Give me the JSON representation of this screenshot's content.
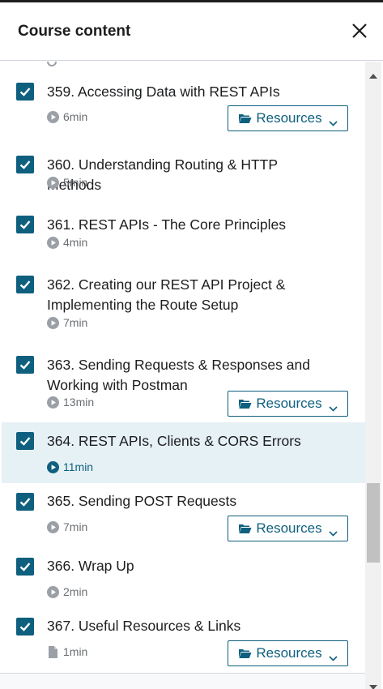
{
  "panel": {
    "title": "Course content"
  },
  "lectures": [
    {
      "title": "359. Accessing Data with REST APIs",
      "duration": "6min",
      "type_icon": "play-circle-icon",
      "completed": true,
      "has_resources": true
    },
    {
      "title": "360. Understanding Routing & HTTP Methods",
      "duration": "5min",
      "type_icon": "play-circle-icon",
      "completed": true,
      "has_resources": false
    },
    {
      "title": "361. REST APIs - The Core Principles",
      "duration": "4min",
      "type_icon": "play-circle-icon",
      "completed": true,
      "has_resources": false
    },
    {
      "title": "362. Creating our REST API Project & Implementing the Route Setup",
      "duration": "7min",
      "type_icon": "play-circle-icon",
      "completed": true,
      "has_resources": false
    },
    {
      "title": "363. Sending Requests & Responses and Working with Postman",
      "duration": "13min",
      "type_icon": "play-circle-icon",
      "completed": true,
      "has_resources": true
    },
    {
      "title": "364. REST APIs, Clients & CORS Errors",
      "duration": "11min",
      "type_icon": "play-circle-icon",
      "completed": true,
      "has_resources": false,
      "active": true
    },
    {
      "title": "365. Sending POST Requests",
      "duration": "7min",
      "type_icon": "play-circle-icon",
      "completed": true,
      "has_resources": true
    },
    {
      "title": "366. Wrap Up",
      "duration": "2min",
      "type_icon": "play-circle-icon",
      "completed": true,
      "has_resources": false
    },
    {
      "title": "367. Useful Resources & Links",
      "duration": "1min",
      "type_icon": "file-icon",
      "completed": true,
      "has_resources": true
    }
  ],
  "resources_label": "Resources",
  "colors": {
    "accent": "#0f5f7e",
    "active_row": "#e6f1f6",
    "text": "#1c1d1f",
    "muted": "#6a6f73"
  }
}
